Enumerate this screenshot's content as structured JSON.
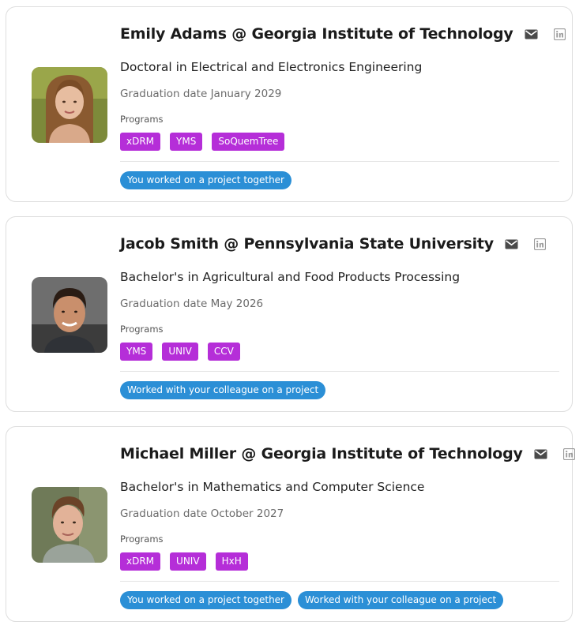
{
  "cards": [
    {
      "name": "Emily Adams @ Georgia Institute of Technology",
      "degree": "Doctoral in Electrical and Electronics Engineering",
      "graduation": "Graduation date January 2029",
      "programs_label": "Programs",
      "programs": [
        "xDRM",
        "YMS",
        "SoQuemTree"
      ],
      "connections": [
        "You worked on a project together"
      ],
      "avatar": "woman-long-hair"
    },
    {
      "name": "Jacob Smith @ Pennsylvania State University",
      "degree": "Bachelor's in Agricultural and Food Products Processing",
      "graduation": "Graduation date May 2026",
      "programs_label": "Programs",
      "programs": [
        "YMS",
        "UNIV",
        "CCV"
      ],
      "connections": [
        "Worked with your colleague on a project"
      ],
      "avatar": "man-short-dark-hair"
    },
    {
      "name": "Michael Miller @ Georgia Institute of Technology",
      "degree": "Bachelor's in Mathematics and Computer Science",
      "graduation": "Graduation date October 2027",
      "programs_label": "Programs",
      "programs": [
        "xDRM",
        "UNIV",
        "HxH"
      ],
      "connections": [
        "You worked on a project together",
        "Worked with your colleague on a project"
      ],
      "avatar": "man-brown-hair"
    }
  ],
  "icons": {
    "email": "envelope-icon",
    "linkedin": "linkedin-icon"
  },
  "colors": {
    "program_tag": "#b52ed8",
    "connection_badge": "#2b8fd6",
    "icon": "#4a4a4a",
    "linkedin_icon": "#9a9a9a"
  }
}
